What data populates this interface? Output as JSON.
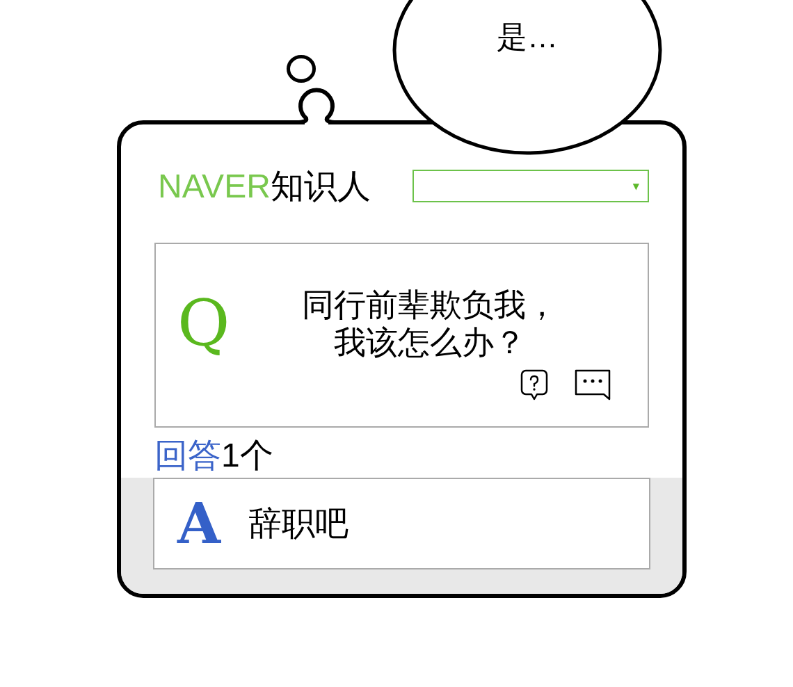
{
  "speech_bubble": {
    "text": "是…"
  },
  "app": {
    "header": {
      "logo": {
        "brand": "NAVER",
        "title": "知识人"
      },
      "dropdown": {
        "arrow": "▼"
      }
    },
    "question": {
      "mark": "Q",
      "text": "同行前辈欺负我，我该怎么办？"
    },
    "answers_heading": {
      "label": "回答",
      "count": "1个"
    },
    "answers": [
      {
        "mark": "A",
        "text": "辞职吧"
      }
    ]
  }
}
